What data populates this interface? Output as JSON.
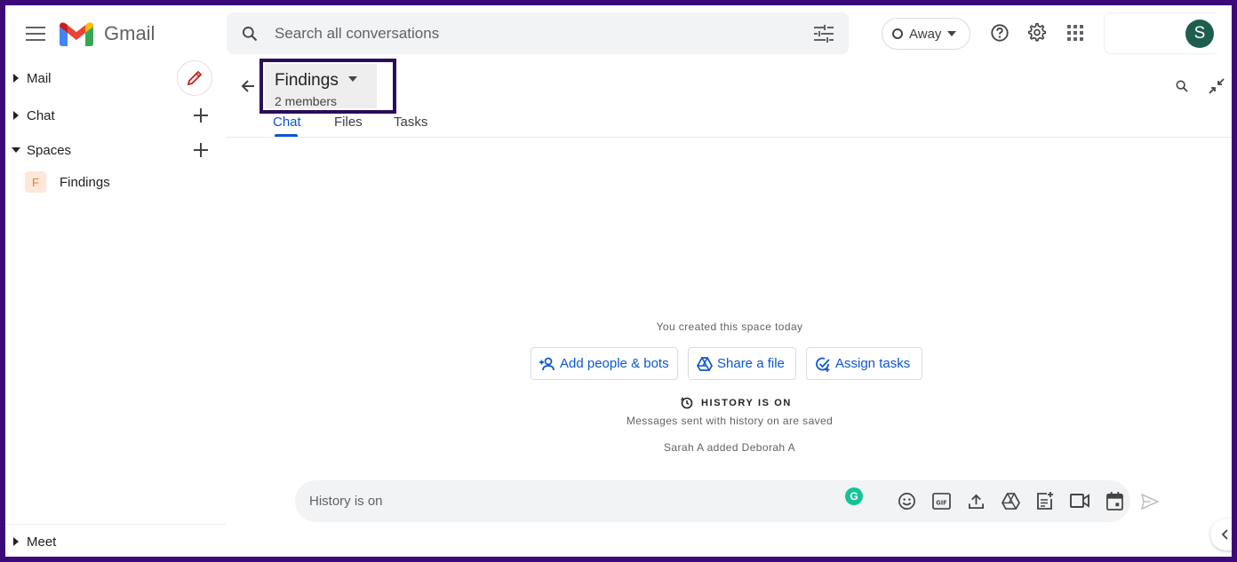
{
  "header": {
    "brand": "Gmail",
    "search_placeholder": "Search all conversations",
    "status_label": "Away",
    "avatar_letter": "S"
  },
  "sidebar": {
    "sections": [
      {
        "label": "Mail"
      },
      {
        "label": "Chat"
      },
      {
        "label": "Spaces"
      }
    ],
    "spaces": [
      {
        "avatar": "F",
        "name": "Findings"
      }
    ],
    "meet_label": "Meet"
  },
  "space": {
    "title": "Findings",
    "subtitle": "2 members",
    "tabs": [
      "Chat",
      "Files",
      "Tasks"
    ],
    "active_tab": "Chat"
  },
  "conversation": {
    "created_text": "You created this space today",
    "actions": [
      {
        "label": "Add people & bots",
        "icon": "person-add-icon"
      },
      {
        "label": "Share a file",
        "icon": "drive-icon"
      },
      {
        "label": "Assign tasks",
        "icon": "add-task-icon"
      }
    ],
    "history_label": "HISTORY IS ON",
    "history_sub": "Messages sent with history on are saved",
    "added_text": "Sarah A added Deborah A"
  },
  "composer": {
    "placeholder": "History is on"
  },
  "colors": {
    "accent": "#0b57d0",
    "frame": "#3b0a78",
    "highlight_border": "#2a0d57",
    "avatar_bg": "#1e5e4e"
  }
}
